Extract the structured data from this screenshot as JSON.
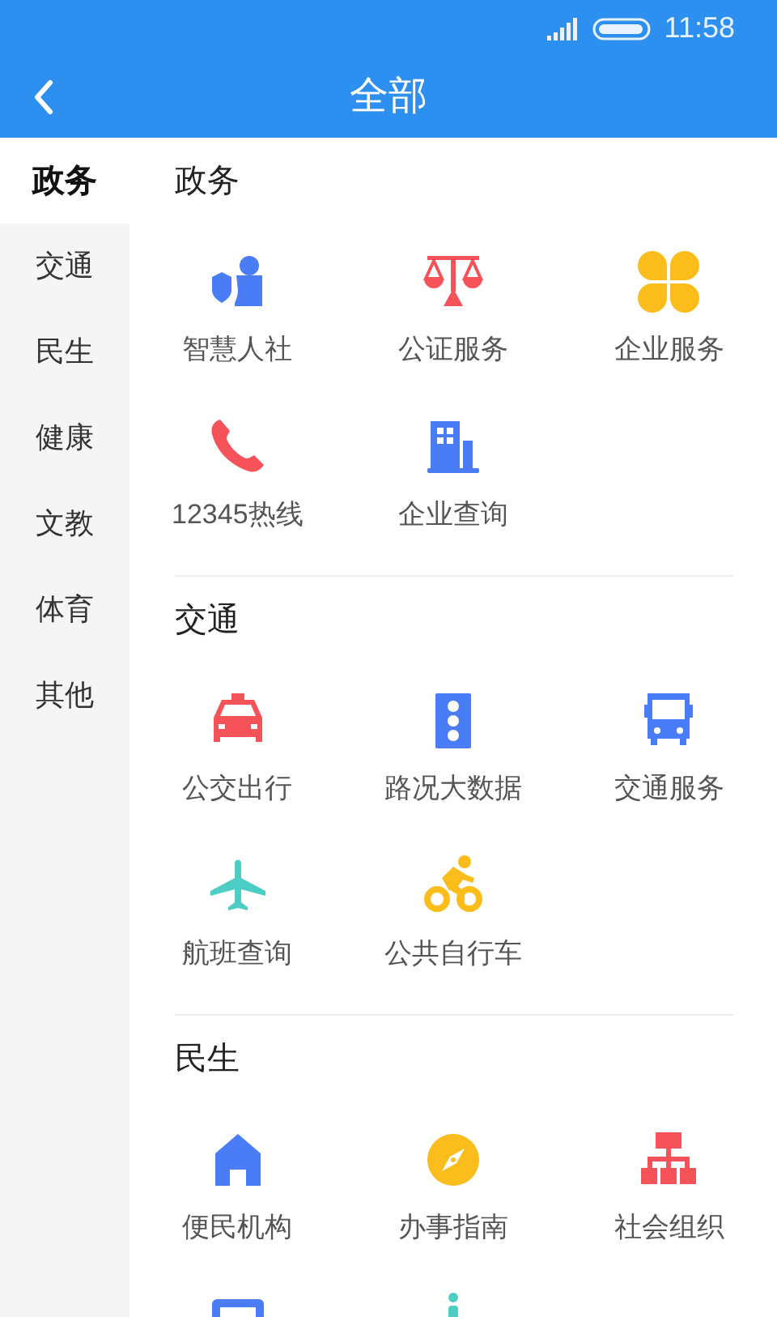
{
  "status_bar": {
    "time": "11:58"
  },
  "header": {
    "title": "全部"
  },
  "sidebar": {
    "items": [
      {
        "label": "政务",
        "selected": true
      },
      {
        "label": "交通",
        "selected": false
      },
      {
        "label": "民生",
        "selected": false
      },
      {
        "label": "健康",
        "selected": false
      },
      {
        "label": "文教",
        "selected": false
      },
      {
        "label": "体育",
        "selected": false
      },
      {
        "label": "其他",
        "selected": false
      }
    ]
  },
  "sections": [
    {
      "title": "政务",
      "items": [
        {
          "label": "智慧人社"
        },
        {
          "label": "公证服务"
        },
        {
          "label": "企业服务"
        },
        {
          "label": "12345热线"
        },
        {
          "label": "企业查询"
        }
      ]
    },
    {
      "title": "交通",
      "items": [
        {
          "label": "公交出行"
        },
        {
          "label": "路况大数据"
        },
        {
          "label": "交通服务"
        },
        {
          "label": "航班查询"
        },
        {
          "label": "公共自行车"
        }
      ]
    },
    {
      "title": "民生",
      "items": [
        {
          "label": "便民机构"
        },
        {
          "label": "办事指南"
        },
        {
          "label": "社会组织"
        }
      ]
    }
  ]
}
